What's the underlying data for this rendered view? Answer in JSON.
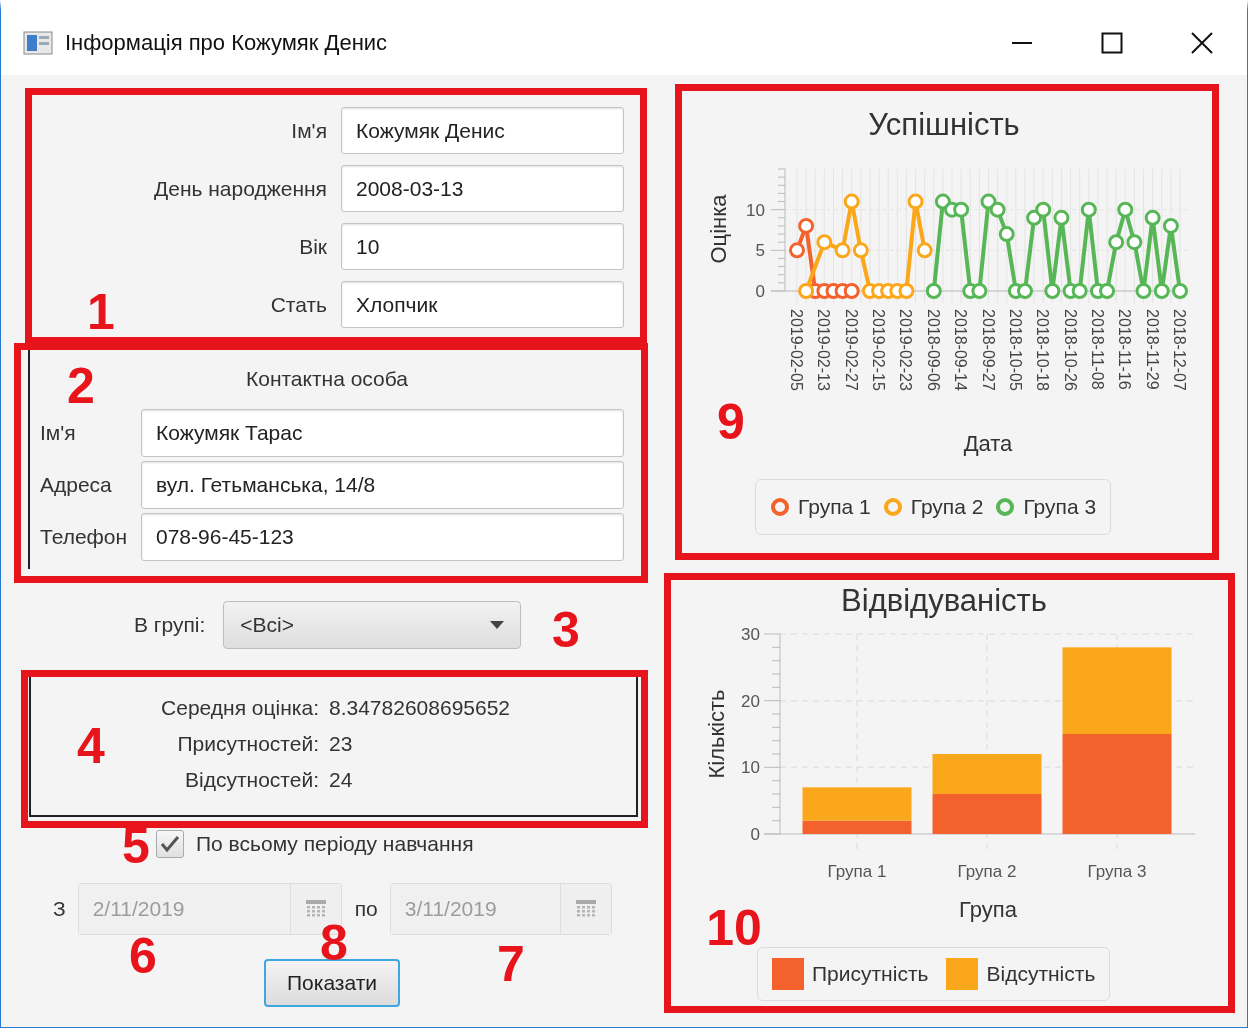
{
  "window": {
    "title": "Інформація про Кожумяк Денис"
  },
  "student": {
    "fields": [
      {
        "label": "Ім'я",
        "value": "Кожумяк Денис"
      },
      {
        "label": "День народження",
        "value": "2008-03-13"
      },
      {
        "label": "Вік",
        "value": "10"
      },
      {
        "label": "Стать",
        "value": "Хлопчик"
      }
    ]
  },
  "contact": {
    "title": "Контактна особа",
    "fields": [
      {
        "label": "Ім'я",
        "value": "Кожумяк Тарас"
      },
      {
        "label": "Адреса",
        "value": "вул. Гетьманська, 14/8"
      },
      {
        "label": "Телефон",
        "value": "078-96-45-123"
      }
    ]
  },
  "group_filter": {
    "label": "В групі:",
    "value": "<Всі>"
  },
  "stats": [
    {
      "label": "Середня оцінка:",
      "value": "8.34782608695652"
    },
    {
      "label": "Присутностей:",
      "value": "23"
    },
    {
      "label": "Відсутностей:",
      "value": "24"
    }
  ],
  "whole_period": {
    "label": "По всьому періоду навчання",
    "checked": true
  },
  "period": {
    "from_label": "З",
    "from": {
      "value": "2/11/2019",
      "disabled": true
    },
    "to_label": "по",
    "to": {
      "value": "3/11/2019",
      "disabled": true
    }
  },
  "show_button": {
    "label": "Показати"
  },
  "performance_chart": {
    "chart_data": {
      "type": "line",
      "title": "Успішність",
      "xlabel": "Дата",
      "ylabel": "Оцінка",
      "categories": [
        "2019-02-05",
        null,
        null,
        "2019-02-13",
        null,
        null,
        "2019-02-27",
        null,
        null,
        "2019-02-15",
        null,
        null,
        "2019-02-23",
        null,
        null,
        "2018-09-06",
        null,
        null,
        "2018-09-14",
        null,
        null,
        "2018-09-27",
        null,
        null,
        "2018-10-05",
        null,
        null,
        "2018-10-18",
        null,
        null,
        "2018-10-26",
        null,
        null,
        "2018-11-08",
        null,
        null,
        "2018-11-16",
        null,
        null,
        "2018-11-29",
        null,
        null,
        "2018-12-07"
      ],
      "ylim": [
        0,
        15
      ],
      "yticks": [
        0,
        5,
        10
      ],
      "grid": true,
      "series": [
        {
          "name": "Група 1",
          "color": "#f3622d",
          "marker": "circle",
          "values": [
            5,
            8,
            0,
            0,
            0,
            0,
            0,
            null,
            null,
            null,
            null,
            null,
            null,
            null,
            null,
            null,
            null,
            null,
            null,
            null,
            null,
            null,
            null,
            null,
            null,
            null,
            null,
            null,
            null,
            null,
            null,
            null,
            null,
            null,
            null,
            null,
            null,
            null,
            null,
            null,
            null,
            null,
            null
          ]
        },
        {
          "name": "Група 2",
          "color": "#fba71b",
          "marker": "circle",
          "values": [
            null,
            0,
            null,
            6,
            null,
            5,
            11,
            5,
            0,
            0,
            0,
            0,
            0,
            11,
            5,
            null,
            null,
            null,
            null,
            null,
            null,
            null,
            null,
            null,
            null,
            null,
            null,
            null,
            null,
            null,
            null,
            null,
            null,
            null,
            null,
            null,
            null,
            null,
            null,
            null,
            null,
            null,
            null
          ]
        },
        {
          "name": "Група 3",
          "color": "#57b757",
          "marker": "circle",
          "values": [
            null,
            null,
            null,
            null,
            null,
            null,
            null,
            null,
            null,
            null,
            null,
            null,
            null,
            null,
            null,
            0,
            11,
            10,
            10,
            0,
            0,
            11,
            10,
            7,
            0,
            0,
            9,
            10,
            0,
            9,
            0,
            0,
            10,
            0,
            0,
            6,
            10,
            6,
            0,
            9,
            0,
            8,
            0
          ]
        }
      ]
    }
  },
  "attendance_chart": {
    "chart_data": {
      "type": "bar",
      "stacked": true,
      "title": "Відвідуваність",
      "xlabel": "Група",
      "ylabel": "Кількість",
      "categories": [
        "Група 1",
        "Група 2",
        "Група 3"
      ],
      "ylim": [
        0,
        30
      ],
      "yticks": [
        0,
        10,
        20,
        30
      ],
      "grid": true,
      "series": [
        {
          "name": "Присутність",
          "color": "#f3622d",
          "values": [
            2,
            6,
            15
          ]
        },
        {
          "name": "Відсутність",
          "color": "#fba71b",
          "values": [
            5,
            6,
            13
          ]
        }
      ]
    }
  },
  "callouts": [
    {
      "number": "1",
      "boxed": true
    },
    {
      "number": "2",
      "boxed": true
    },
    {
      "number": "3",
      "boxed": false
    },
    {
      "number": "4",
      "boxed": true
    },
    {
      "number": "5",
      "boxed": false
    },
    {
      "number": "6",
      "boxed": false
    },
    {
      "number": "8",
      "boxed": false
    },
    {
      "number": "7",
      "boxed": false
    },
    {
      "number": "9",
      "boxed": true
    },
    {
      "number": "10",
      "boxed": true
    }
  ]
}
